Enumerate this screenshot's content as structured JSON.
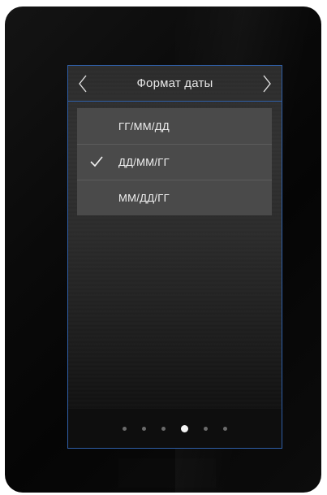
{
  "header": {
    "title": "Формат даты"
  },
  "date_formats": {
    "options": [
      {
        "label": "ГГ/ММ/ДД",
        "selected": false
      },
      {
        "label": "ДД/ММ/ГГ",
        "selected": true
      },
      {
        "label": "ММ/ДД/ГГ",
        "selected": false
      }
    ]
  },
  "pager": {
    "total_pages": 6,
    "current_page": 4
  },
  "colors": {
    "accent_border": "#2f5fa8",
    "list_background": "#4a4a4a",
    "text": "#f2f2f2"
  }
}
